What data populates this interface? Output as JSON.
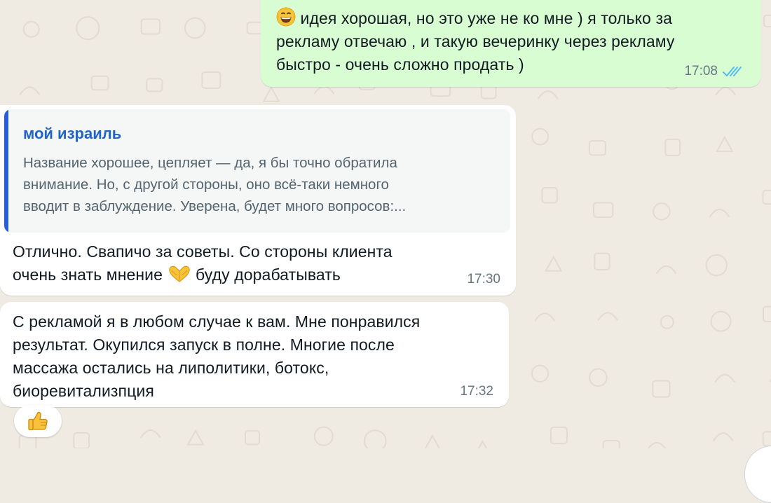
{
  "chat": {
    "wallpaper": {
      "background": "#efeae2",
      "doodle_color": "#e2dbd0"
    },
    "messages": [
      {
        "direction": "outgoing",
        "emoji": "grinning-face",
        "text_lines": [
          "идея хорошая, но это уже не ко мне ) я только за",
          "рекламу отвечаю , и такую вечеринку через рекламу",
          "быстро - очень сложно продать )"
        ],
        "time": "17:08",
        "status_icon": "double-check-read-icon",
        "bubble_color": "#d9fdd3"
      },
      {
        "direction": "incoming",
        "quote": {
          "author": "мой израиль",
          "text_lines": [
            "Название хорошее, цепляет — да, я бы точно обратила",
            "внимание. Но, с другой стороны, оно всё-таки немного",
            "вводит в заблуждение. Уверена, будет много вопросов:..."
          ],
          "author_color": "#1f63c9",
          "bar_color": "#2a5ed8"
        },
        "line1": "Отлично. Свапичо за советы. Со стороны клиента",
        "line2_before": "очень знать мнение",
        "emoji": "heart-hands",
        "line2_after": "буду дорабатывать",
        "time": "17:30"
      },
      {
        "direction": "incoming",
        "text_lines": [
          "С рекламой я в любом случае к вам. Мне понравился",
          "результат. Окупился запуск в полне. Многие после",
          "массажа остались на липолитики, ботокс,",
          "биоревитализпция"
        ],
        "time": "17:32",
        "reaction": "thumbs-up"
      }
    ]
  }
}
